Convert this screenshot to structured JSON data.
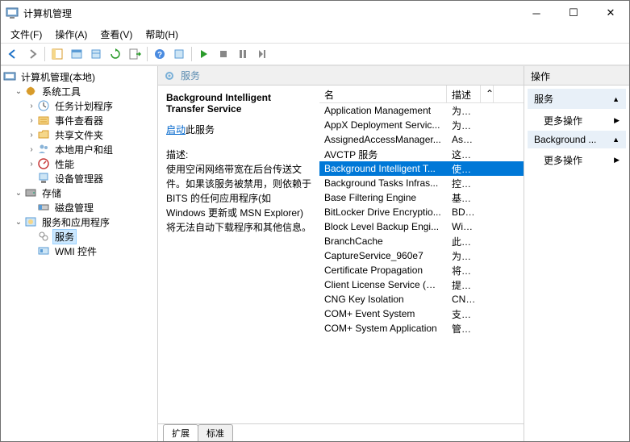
{
  "window": {
    "title": "计算机管理"
  },
  "menu": {
    "file": "文件(F)",
    "action": "操作(A)",
    "view": "查看(V)",
    "help": "帮助(H)"
  },
  "tree": {
    "root": "计算机管理(本地)",
    "systools": "系统工具",
    "taskscheduler": "任务计划程序",
    "eventviewer": "事件查看器",
    "sharedfolders": "共享文件夹",
    "localusers": "本地用户和组",
    "performance": "性能",
    "devicemanager": "设备管理器",
    "storage": "存储",
    "diskmgmt": "磁盘管理",
    "servicesapps": "服务和应用程序",
    "services": "服务",
    "wmi": "WMI 控件"
  },
  "center": {
    "header": "服务",
    "detail_title": "Background Intelligent Transfer Service",
    "start_link": "启动",
    "start_suffix": "此服务",
    "desc_label": "描述:",
    "desc_text": "使用空闲网络带宽在后台传送文件。如果该服务被禁用，则依赖于 BITS 的任何应用程序(如 Windows 更新或 MSN Explorer)将无法自动下载程序和其他信息。",
    "col_name": "名",
    "col_desc": "描述",
    "tab_ext": "扩展",
    "tab_std": "标准"
  },
  "services": [
    {
      "name": "Application Management",
      "desc": "为通..."
    },
    {
      "name": "AppX Deployment Servic...",
      "desc": "为部..."
    },
    {
      "name": "AssignedAccessManager...",
      "desc": "Assi..."
    },
    {
      "name": "AVCTP 服务",
      "desc": "这是..."
    },
    {
      "name": "Background Intelligent T...",
      "desc": "使用..."
    },
    {
      "name": "Background Tasks Infras...",
      "desc": "控制..."
    },
    {
      "name": "Base Filtering Engine",
      "desc": "基本..."
    },
    {
      "name": "BitLocker Drive Encryptio...",
      "desc": "BDE..."
    },
    {
      "name": "Block Level Backup Engi...",
      "desc": "Win..."
    },
    {
      "name": "BranchCache",
      "desc": "此服..."
    },
    {
      "name": "CaptureService_960e7",
      "desc": "为调..."
    },
    {
      "name": "Certificate Propagation",
      "desc": "将用..."
    },
    {
      "name": "Client License Service (Cli...",
      "desc": "提供..."
    },
    {
      "name": "CNG Key Isolation",
      "desc": "CNG..."
    },
    {
      "name": "COM+ Event System",
      "desc": "支持..."
    },
    {
      "name": "COM+ System Application",
      "desc": "管理..."
    }
  ],
  "selected_index": 4,
  "actions": {
    "header": "操作",
    "group1": "服务",
    "group2": "Background ...",
    "more": "更多操作"
  }
}
